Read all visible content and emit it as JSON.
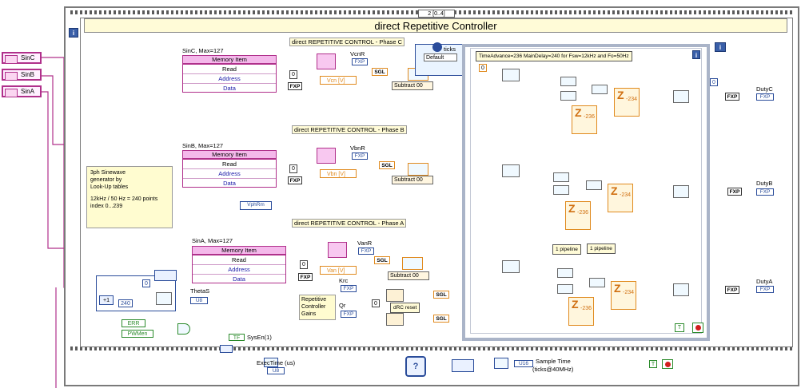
{
  "sequence": {
    "selector": "2 [0..4]",
    "title": "direct Repetitive Controller"
  },
  "inputs": [
    {
      "label": "SinC"
    },
    {
      "label": "SinB"
    },
    {
      "label": "SinA"
    }
  ],
  "memory_blocks": [
    {
      "caption": "SinC, Max=127",
      "title": "Memory Item",
      "rows": [
        "Read",
        "Address",
        "Data"
      ]
    },
    {
      "caption": "SinB, Max=127",
      "title": "Memory Item",
      "rows": [
        "Read",
        "Address",
        "Data"
      ]
    },
    {
      "caption": "SinA, Max=127",
      "title": "Memory Item",
      "rows": [
        "Read",
        "Address",
        "Data"
      ]
    }
  ],
  "phases": [
    {
      "label": "direct REPETITIVE CONTROL - Phase C",
      "ref": "VcnR",
      "meas": "Vcn [V]",
      "sub": "Subtract 00",
      "fxp": "FXP",
      "const": "0"
    },
    {
      "label": "direct REPETITIVE CONTROL - Phase B",
      "ref": "VbnR",
      "meas": "Vbn [V]",
      "sub": "Subtract 00",
      "fxp": "FXP",
      "const": "0"
    },
    {
      "label": "direct REPETITIVE CONTROL - Phase A",
      "ref": "VanR",
      "meas": "Van [V]",
      "sub": "Subtract 00",
      "fxp": "FXP",
      "const": "0"
    }
  ],
  "vphrm": "VphRm",
  "note": [
    "3ph Sinewave",
    "generator by",
    "Look-Up tables",
    "",
    "12kHz / 50 Hz = 240 points",
    "index 0...239"
  ],
  "theta": {
    "const": "240",
    "indicator": "ThetaS",
    "type": "U8"
  },
  "ticks": {
    "label": "ticks",
    "case": "Default"
  },
  "timing_note": "TimeAdvance=236   MainDelay=240 for Fsw=12kHz and Fo=50Hz",
  "gains": {
    "krc": "Krc",
    "qr": "Qr",
    "reset": "dRC reset",
    "label": [
      "Repetitive",
      "Controller",
      "Gains"
    ],
    "sgl": "SGL",
    "zero": "0"
  },
  "errs": {
    "err": "ERR",
    "pwmen": "PWMen",
    "sysen": "SysEn(1)"
  },
  "pipeline_labels": [
    "1 pipeline",
    "1 pipeline"
  ],
  "delays": [
    "-236",
    "-234",
    "-236",
    "-234",
    "-236",
    "-234"
  ],
  "duty": [
    {
      "label": "DutyC"
    },
    {
      "label": "DutyB"
    },
    {
      "label": "DutyA"
    }
  ],
  "sctl": "SCTL",
  "exec": {
    "label": "ExecTime (us)",
    "type": "U8"
  },
  "sample": {
    "label": "Sample Time",
    "sub": "(ticks@40MHz)",
    "type": "U16"
  },
  "const_zero": "0",
  "fxp_text": "FXP",
  "sgl_text": "SGL",
  "info_icon": "i"
}
